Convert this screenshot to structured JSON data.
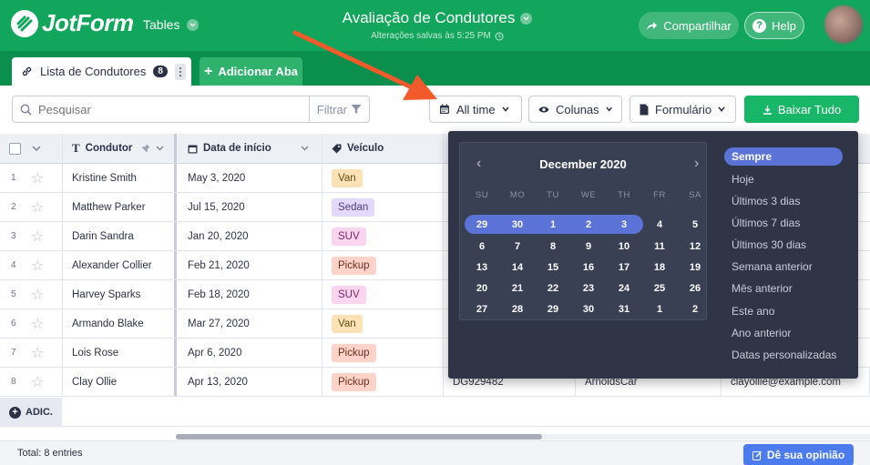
{
  "header": {
    "logo_text": "JotForm",
    "app_switch": "Tables",
    "title": "Avaliação de Condutores",
    "subtitle": "Alterações salvas às 5:25 PM",
    "share": "Compartilhar",
    "help": "Help"
  },
  "tabs": {
    "active_label": "Lista de Condutores",
    "active_count": "8",
    "add_label": "Adicionar Aba"
  },
  "toolbar": {
    "search_placeholder": "Pesquisar",
    "filter": "Filtrar",
    "date_range": "All time",
    "columns": "Colunas",
    "form": "Formulário",
    "download": "Baixar Tudo"
  },
  "table": {
    "headers": [
      "Condutor",
      "Data de início",
      "Veículo"
    ],
    "rows": [
      {
        "num": "1",
        "name": "Kristine Smith",
        "date": "May 3, 2020",
        "vehicle": "Van"
      },
      {
        "num": "2",
        "name": "Matthew Parker",
        "date": "Jul 15, 2020",
        "vehicle": "Sedan"
      },
      {
        "num": "3",
        "name": "Darin Sandra",
        "date": "Jan 20, 2020",
        "vehicle": "SUV"
      },
      {
        "num": "4",
        "name": "Alexander Collier",
        "date": "Feb 21, 2020",
        "vehicle": "Pickup"
      },
      {
        "num": "5",
        "name": "Harvey Sparks",
        "date": "Feb 18, 2020",
        "vehicle": "SUV"
      },
      {
        "num": "6",
        "name": "Armando Blake",
        "date": "Mar 27, 2020",
        "vehicle": "Van"
      },
      {
        "num": "7",
        "name": "Lois Rose",
        "date": "Apr 6, 2020",
        "vehicle": "Pickup"
      },
      {
        "num": "8",
        "name": "Clay Ollie",
        "date": "Apr 13, 2020",
        "vehicle": "Pickup",
        "plate": "DG929482",
        "company": "ArnoldsCar",
        "email": "clayollie@example.com"
      }
    ],
    "add_label": "ADIC."
  },
  "footer": {
    "total": "Total: 8 entries",
    "feedback": "Dê sua opinião"
  },
  "calendar": {
    "month": "December 2020",
    "weekdays": [
      "SU",
      "MO",
      "TU",
      "WE",
      "TH",
      "FR",
      "SA"
    ],
    "weeks": [
      [
        "29",
        "30",
        "1",
        "2",
        "3",
        "4",
        "5"
      ],
      [
        "6",
        "7",
        "8",
        "9",
        "10",
        "11",
        "12"
      ],
      [
        "13",
        "14",
        "15",
        "16",
        "17",
        "18",
        "19"
      ],
      [
        "20",
        "21",
        "22",
        "23",
        "24",
        "25",
        "26"
      ],
      [
        "27",
        "28",
        "29",
        "30",
        "31",
        "1",
        "2"
      ]
    ],
    "highlighted_range": [
      "29",
      "30",
      "1",
      "2",
      "3"
    ]
  },
  "date_options": [
    "Sempre",
    "Hoje",
    "Últimos 3 dias",
    "Últimos 7 dias",
    "Últimos 30 dias",
    "Semana anterior",
    "Mês anterior",
    "Este ano",
    "Ano anterior",
    "Datas personalizadas"
  ],
  "selected_option": "Sempre",
  "colors": {
    "header_green": "#12a55c",
    "tab_green": "#0a8f4c",
    "download_green": "#18b768",
    "accent_blue": "#5b73d6",
    "dropdown_bg": "#2f3547",
    "annotation_arrow": "#f2592b"
  }
}
